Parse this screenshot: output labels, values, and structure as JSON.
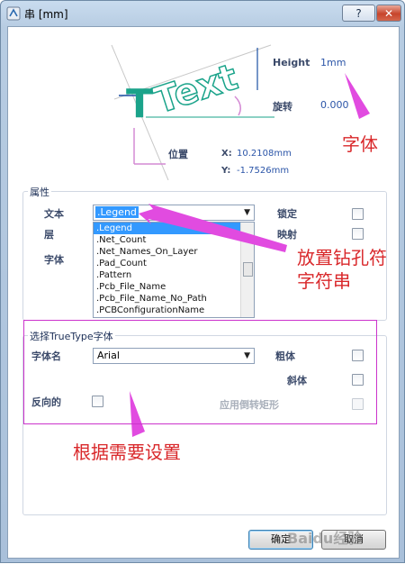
{
  "window": {
    "title": "串 [mm]",
    "help_label": "?",
    "close_label": "✕"
  },
  "preview": {
    "sample_text": "Text",
    "height_label": "Height",
    "height_value": "1mm",
    "rotation_label": "旋转",
    "rotation_value": "0.000",
    "position_label": "位置",
    "x_label": "X:",
    "x_value": "10.2108mm",
    "y_label": "Y:",
    "y_value": "-1.7526mm"
  },
  "properties": {
    "group_title": "属性",
    "text_label": "文本",
    "text_value": ".Legend",
    "layer_label": "层",
    "font_label": "字体",
    "lock_label": "锁定",
    "mirror_label": "映射",
    "dropdown_items": [
      ".Legend",
      ".Net_Count",
      ".Net_Names_On_Layer",
      ".Pad_Count",
      ".Pattern",
      ".Pcb_File_Name",
      ".Pcb_File_Name_No_Path",
      ".PCBConfigurationName"
    ]
  },
  "truetype": {
    "group_title": "选择TrueType字体",
    "font_name_label": "字体名",
    "font_name_value": "Arial",
    "bold_label": "粗体",
    "italic_label": "斜体",
    "inverted_label": "反向的",
    "inverted_rect_label": "应用倒转矩形"
  },
  "buttons": {
    "ok_label": "确定",
    "cancel_label": "取消"
  },
  "annotations": {
    "font_note": "字体",
    "place_note_line1": "放置钻孔符",
    "place_note_line2": "字符串",
    "settings_note": "根据需要设置",
    "watermark": "Baidu经验"
  },
  "colors": {
    "accent_green": "#1aa38a",
    "annotation_red": "#d9282b",
    "annotation_magenta": "#cc33cc"
  }
}
